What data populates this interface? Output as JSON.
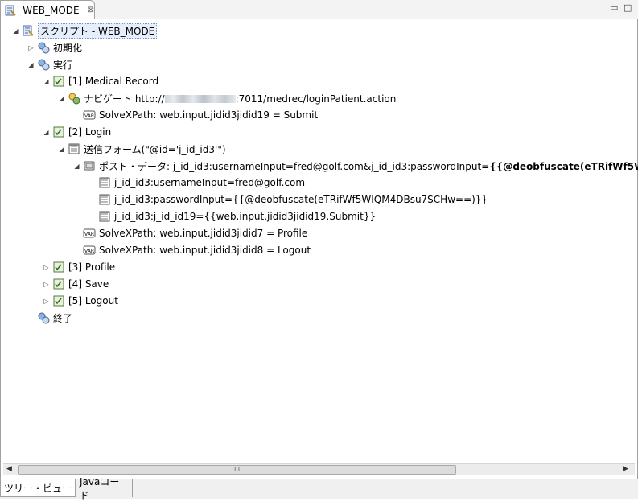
{
  "editor_tab": {
    "title": "WEB_MODE",
    "close": "⊠"
  },
  "window_controls": {
    "minimize": "▭",
    "maximize": "□"
  },
  "tree": {
    "root": "スクリプト - WEB_MODE",
    "init": "初期化",
    "exec": "実行",
    "step1": "[1] Medical Record",
    "navigate_prefix": "ナビゲート http://",
    "navigate_suffix": ":7011/medrec/loginPatient.action",
    "solve1": "SolveXPath: web.input.jidid3jidid19 = Submit",
    "step2": "[2] Login",
    "form": "送信フォーム(\"@id='j_id_id3'\")",
    "post_prefix": "ポスト・データ: j_id_id3:usernameInput=fred@golf.com&j_id_id3:passwordInput=",
    "post_bold": "{{@deobfuscate(eTRifWf5W",
    "param1": "j_id_id3:usernameInput=fred@golf.com",
    "param2": "j_id_id3:passwordInput={{@deobfuscate(eTRifWf5WIQM4DBsu7SCHw==)}}",
    "param3": "j_id_id3:j_id_id19={{web.input.jidid3jidid19,Submit}}",
    "solve2": "SolveXPath: web.input.jidid3jidid7 = Profile",
    "solve3": "SolveXPath: web.input.jidid3jidid8 = Logout",
    "step3": "[3] Profile",
    "step4": "[4] Save",
    "step5": "[5] Logout",
    "end": "終了"
  },
  "scrollbar": {
    "grip": "III"
  },
  "bottom_tabs": {
    "tree_view": "ツリー・ビュー",
    "java_code": "Javaコード"
  }
}
